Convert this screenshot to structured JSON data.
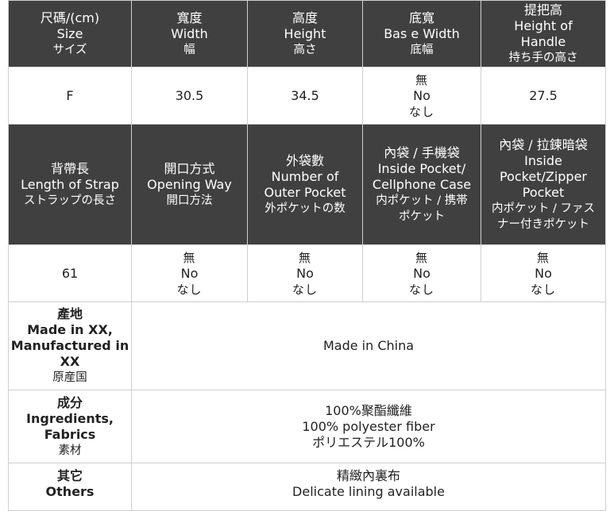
{
  "header1": [
    {
      "zh": "尺碼/(cm)",
      "en": "Size",
      "jp": "サイズ"
    },
    {
      "zh": "寬度",
      "en": "Width",
      "jp": "幅"
    },
    {
      "zh": "高度",
      "en": "Height",
      "jp": "高さ"
    },
    {
      "zh": "底寬",
      "en": "Bas e Width",
      "jp": "底幅"
    },
    {
      "zh": "提把高",
      "en": "Height of Handle",
      "jp": "持ち手の高さ"
    }
  ],
  "values1": {
    "size": "F",
    "width": "30.5",
    "height": "34.5",
    "base_width": {
      "zh": "無",
      "en": "No",
      "jp": "なし"
    },
    "handle": "27.5"
  },
  "header2": [
    {
      "zh": "背帶長",
      "en": "Length of Strap",
      "jp": "ストラップの長さ"
    },
    {
      "zh": "開口方式",
      "en": "Opening Way",
      "jp": "開口方法"
    },
    {
      "zh": "外袋數",
      "en": "Number of Outer Pocket",
      "jp": "外ポケットの数"
    },
    {
      "zh": "內袋 / 手機袋",
      "en": "Inside Pocket/ Cellphone Case",
      "jp": "内ポケット / 携帯ポケット"
    },
    {
      "zh": "內袋 / 拉鍊暗袋",
      "en": "Inside Pocket/Zipper Pocket",
      "jp": "内ポケット / ファスナー付きポケット"
    }
  ],
  "values2": {
    "strap": "61",
    "none": {
      "zh": "無",
      "en": "No",
      "jp": "なし"
    }
  },
  "origin": {
    "label": {
      "zh": "產地",
      "en": "Made in XX, Manufactured in XX",
      "jp": "原産国"
    },
    "value": "Made in China"
  },
  "ingredients": {
    "label": {
      "zh": "成分",
      "en": "Ingredients, Fabrics",
      "jp": "素材"
    },
    "value": [
      "100%聚酯纖維",
      "100% polyester fiber",
      "ポリエステル100%"
    ]
  },
  "others": {
    "label": {
      "zh": "其它",
      "en": "Others"
    },
    "value": [
      "精緻內裏布",
      "Delicate lining available"
    ]
  }
}
